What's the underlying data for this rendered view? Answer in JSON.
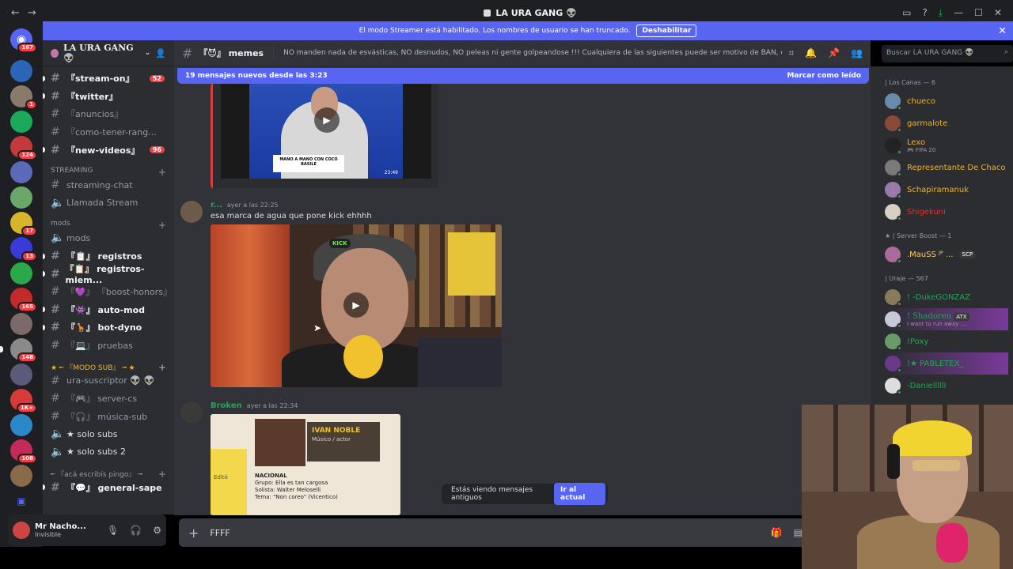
{
  "titlebar": {
    "back": "←",
    "forward": "→",
    "title": "LA URA GANG 👽"
  },
  "banner": {
    "text": "El modo Streamer está habilitado. Los nombres de usuario se han truncado.",
    "button": "Deshabilitar"
  },
  "server_badges": [
    "167",
    "1",
    "124",
    "17",
    "13",
    "165",
    "148",
    "1K+",
    "108"
  ],
  "guild": {
    "name": "LA URA GANG 👽"
  },
  "channels": [
    {
      "label": "『stream-on』",
      "count": "52",
      "unread": true
    },
    {
      "label": "『twitter』",
      "unread": true
    },
    {
      "label": "『anuncios』"
    },
    {
      "label": "『como-tener-rang..."
    },
    {
      "label": "『new-videos』",
      "count": "96",
      "unread": true
    }
  ],
  "categories": {
    "streaming": "STREAMING",
    "mods": "mods",
    "modo_sub": "★ ╾ 『MODO SUB』 ╼ ★",
    "aca": "╾ 『acá escribís pingo』 ╼"
  },
  "streaming_channels": [
    "streaming-chat",
    "Llamada Stream"
  ],
  "mod_channels": [
    {
      "label": "mods"
    },
    {
      "label": "『📋』 registros",
      "unread": true
    },
    {
      "label": "『📋』 registros-miem...",
      "unread": true
    },
    {
      "label": "『💜』 『boost-honors』"
    },
    {
      "label": "『👾』 auto-mod",
      "unread": true
    },
    {
      "label": "『🦒』 bot-dyno",
      "unread": true
    },
    {
      "label": "『💻』 pruebas"
    }
  ],
  "sub_channels": [
    {
      "label": "ura-suscriptor 👽 👽"
    },
    {
      "label": "『🎮』 server-cs"
    },
    {
      "label": "『🎧』 música-sub"
    },
    {
      "label": "★ solo subs"
    },
    {
      "label": "★ solo subs 2"
    }
  ],
  "general_channel": "『💬』 general-sape",
  "user": {
    "name": "Mr Nacho...",
    "status": "Invisible"
  },
  "chat_header": {
    "channel": "『😈』 memes",
    "topic": "NO manden nada de esvásticas, NO desnudos, NO peleas ni gente golpeandose !!! Cualquiera de las siguientes puede ser motivo de BAN, cuiden el stream!"
  },
  "search": {
    "placeholder": "Buscar LA URA GANG 👽"
  },
  "new_messages": {
    "text": "19 mensajes nuevos desde las 3:23",
    "action": "Marcar como leído"
  },
  "video1": {
    "lower_third": "MANO A MANO CON COCO BASILE",
    "duration": "23:49"
  },
  "messages": [
    {
      "author": "r...",
      "time": "ayer a las 22:25",
      "text": "esa marca de agua que pone kick ehhhh"
    },
    {
      "author": "Broken",
      "time": "ayer a las 22:34"
    }
  ],
  "video2": {
    "watermark": "KICK"
  },
  "card": {
    "name": "IVAN NOBLE",
    "role": "Músico / actor",
    "edit": "Editó",
    "section": "NACIONAL",
    "lines": [
      "Grupo: Ella es tan cargosa",
      "Solista: Walter Meloselli",
      "Tema: \"Non coreo\" (Vicentico)"
    ]
  },
  "old_messages": {
    "text": "Estás viendo mensajes antiguos",
    "button": "Ir al actual"
  },
  "composer": {
    "value": "FFFF"
  },
  "member_groups": [
    {
      "label": "| Los Canas — 6",
      "members": [
        {
          "name": "chueco",
          "color": "#f0b232"
        },
        {
          "name": "garmalote",
          "color": "#f0b232"
        },
        {
          "name": "Lexo",
          "activity": "🎮 FIFA 20",
          "color": "#f0b232"
        },
        {
          "name": "Representante De Chaco",
          "color": "#f0b232"
        },
        {
          "name": "Schapiramanuk",
          "color": "#f0b232"
        },
        {
          "name": "Shigekuni",
          "color": "#e03030"
        }
      ]
    },
    {
      "label": "★ | Server Boost — 1",
      "members": [
        {
          "name": ".MauSS ᴶᴾ ...",
          "color": "#ffcc66",
          "tag": "SCP"
        }
      ]
    },
    {
      "label": "| Uraje — 567",
      "members": [
        {
          "name": "! -DukeGONZAZ",
          "color": "#23a559"
        },
        {
          "name": "! Shadoren",
          "activity": "I want to run away ...",
          "tag": "ATX",
          "color": "#23a559"
        },
        {
          "name": "!Poxy",
          "color": "#23a559"
        },
        {
          "name": "!★ PABLETEX_",
          "color": "#23a559"
        },
        {
          "name": "-Daniellllll",
          "color": "#23a559"
        }
      ]
    }
  ]
}
